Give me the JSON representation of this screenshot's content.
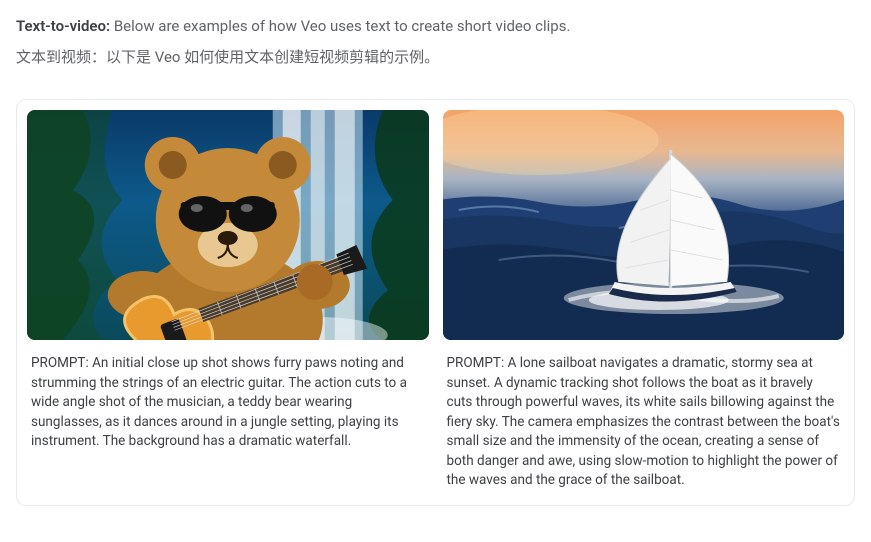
{
  "heading": {
    "bold": "Text-to-video:",
    "rest": " Below are examples of how Veo uses text to create short video clips."
  },
  "subheading": "文本到视频：以下是 Veo 如何使用文本创建短视频剪辑的示例。",
  "examples": [
    {
      "prompt_label": "PROMPT:",
      "prompt_text": " An initial close up shot shows furry paws noting and strumming the strings of an electric guitar. The action cuts to a wide angle shot of the musician, a teddy bear wearing sunglasses, as it dances around in a jungle setting, playing its instrument. The background has a dramatic waterfall."
    },
    {
      "prompt_label": "PROMPT:",
      "prompt_text": " A lone sailboat navigates a dramatic, stormy sea at sunset. A dynamic tracking shot follows the boat as it bravely cuts through powerful waves, its white sails billowing against the fiery sky. The camera emphasizes the contrast between the boat's small size and the immensity of the ocean, creating a sense of both danger and awe, using slow-motion to highlight the power of the waves and the grace of the sailboat."
    }
  ]
}
